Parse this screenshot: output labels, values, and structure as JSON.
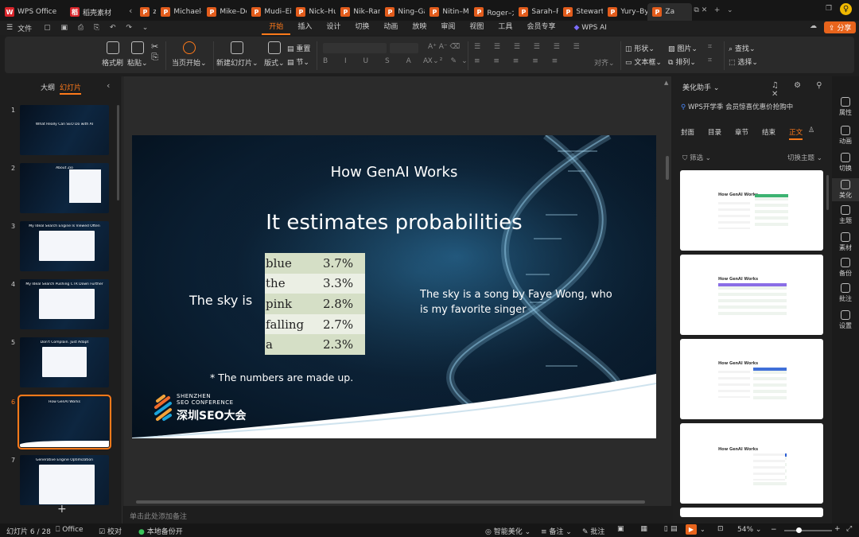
{
  "tabs": [
    {
      "label": "WPS Office",
      "color": "#d9252b",
      "glyph": "W"
    },
    {
      "label": "稻壳素材",
      "color": "#d9252b",
      "glyph": "稻"
    },
    {
      "label": "zio·",
      "color": "#e25c1c",
      "glyph": "P"
    },
    {
      "label": "Michael–",
      "color": "#e25c1c",
      "glyph": "P"
    },
    {
      "label": "Mike–Der",
      "color": "#e25c1c",
      "glyph": "P"
    },
    {
      "label": "Mudi–Eis",
      "color": "#e25c1c",
      "glyph": "P"
    },
    {
      "label": "Nick–Hu",
      "color": "#e25c1c",
      "glyph": "P"
    },
    {
      "label": "Nik–Ranc",
      "color": "#e25c1c",
      "glyph": "P"
    },
    {
      "label": "Ning–Gar",
      "color": "#e25c1c",
      "glyph": "P"
    },
    {
      "label": "Nitin–Ma",
      "color": "#e25c1c",
      "glyph": "P"
    },
    {
      "label": "Roger–大",
      "color": "#e25c1c",
      "glyph": "P"
    },
    {
      "label": "Sarah–Pe",
      "color": "#e25c1c",
      "glyph": "P"
    },
    {
      "label": "Stewart–",
      "color": "#e25c1c",
      "glyph": "P"
    },
    {
      "label": "Yury–Byp",
      "color": "#e25c1c",
      "glyph": "P"
    },
    {
      "label": "Za",
      "color": "#e25c1c",
      "glyph": "P"
    }
  ],
  "menu": {
    "file": "文件",
    "items": [
      "开始",
      "插入",
      "设计",
      "切换",
      "动画",
      "放映",
      "审阅",
      "视图",
      "工具",
      "会员专享"
    ],
    "selected": "开始",
    "wpsai": "WPS AI",
    "share": "分享"
  },
  "ribbon": {
    "format_painter": "格式刷",
    "paste": "粘贴",
    "play_from_current": "当页开始",
    "new_slide": "新建幻灯片",
    "layout": "版式",
    "section": "节",
    "reset": "重置",
    "align": "对齐",
    "shape": "形状",
    "textbox": "文本框",
    "picture": "图片",
    "arrange": "排列",
    "find": "查找",
    "select": "选择"
  },
  "left_panel": {
    "outline": "大纲",
    "slides": "幻灯片",
    "add": "+"
  },
  "thumbnails": [
    {
      "num": "1",
      "title": "What Really Can SEO Do with AI"
    },
    {
      "num": "2",
      "title": "About Zio"
    },
    {
      "num": "3",
      "title": "My Ideal Search Engine Is Viewed Often"
    },
    {
      "num": "4",
      "title": "My Ideal Search Pushing CTR Down Further"
    },
    {
      "num": "5",
      "title": "Don't Complain. Just Adapt"
    },
    {
      "num": "6",
      "title": "How GenAI Works"
    },
    {
      "num": "7",
      "title": "Generative Engine Optimization"
    }
  ],
  "slide": {
    "header": "How GenAI Works",
    "title": "It estimates probabilities",
    "prompt": "The sky is",
    "table": [
      [
        "blue",
        "3.7%"
      ],
      [
        "the",
        "3.3%"
      ],
      [
        "pink",
        "2.8%"
      ],
      [
        "falling",
        "2.7%"
      ],
      [
        "a",
        "2.3%"
      ]
    ],
    "answer": "The sky is a song by Faye Wong, who is my favorite singer",
    "footnote": "* The numbers are made up.",
    "logo_line1": "SHENZHEN",
    "logo_line2": "SEO CONFERENCE",
    "logo_cn": "深圳SEO大会"
  },
  "notes_placeholder": "单击此处添加备注",
  "right_panel": {
    "title": "美化助手",
    "promo": "WPS开学季 会员惊喜优惠价抢购中",
    "tabs": [
      "封面",
      "目录",
      "章节",
      "结束",
      "正文"
    ],
    "selected_tab": "正文",
    "filter": "筛选",
    "switch_theme": "切换主题",
    "card_title": "How GenAI Works"
  },
  "sidebar": [
    "属性",
    "动画",
    "切换",
    "美化",
    "主题",
    "素材",
    "备份",
    "批注",
    "设置"
  ],
  "status": {
    "slide_count": "幻灯片 6 / 28",
    "office": "Office",
    "proof": "校对",
    "backup": "本地备份开",
    "beautify": "智能美化",
    "notes": "备注",
    "comments": "批注",
    "zoom": "54%"
  },
  "colors": {
    "accent": "#ff7a1a",
    "table_a": "#d5dfc6",
    "table_b": "#ebefe4"
  }
}
